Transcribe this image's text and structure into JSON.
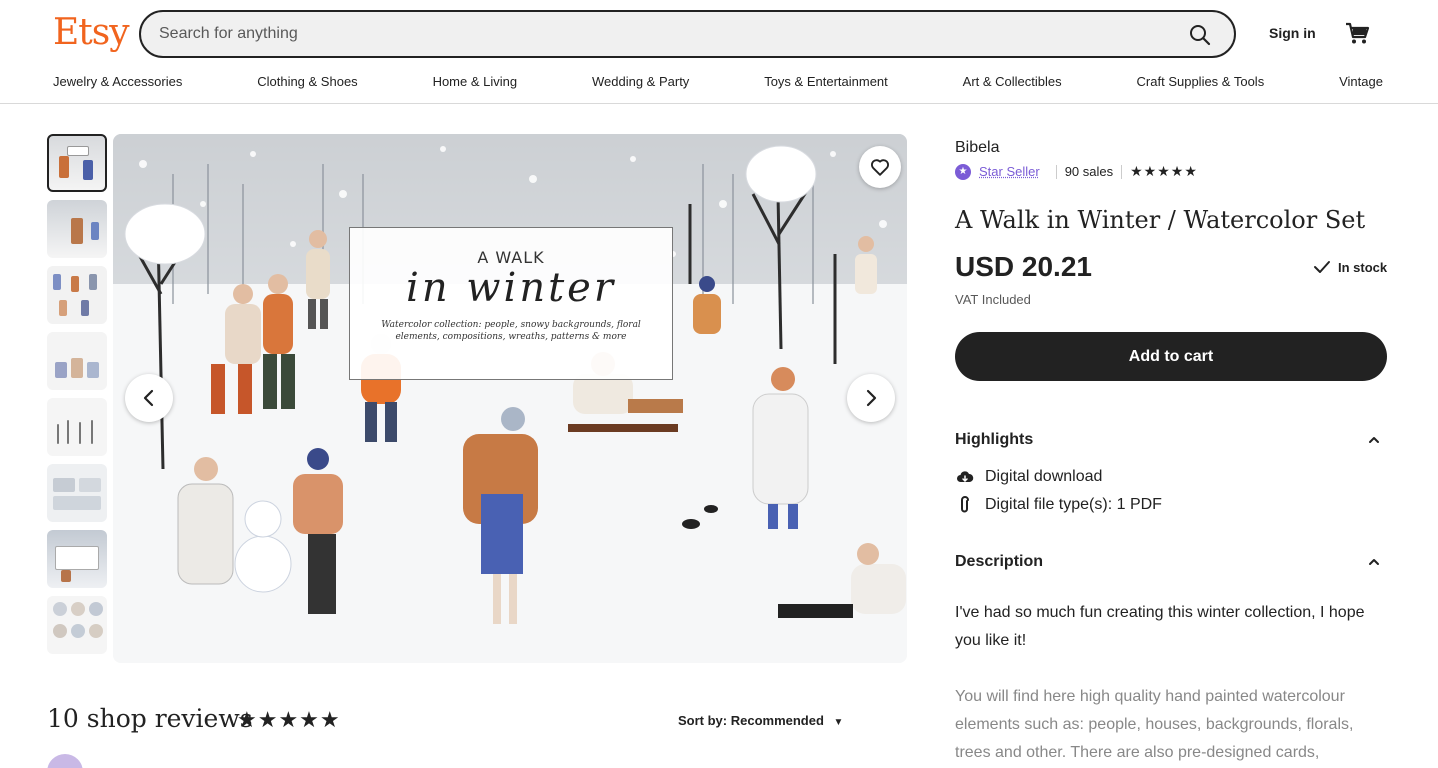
{
  "header": {
    "logo": "Etsy",
    "search_placeholder": "Search for anything",
    "sign_in": "Sign in",
    "icons": [
      "search-icon",
      "cart-icon"
    ]
  },
  "categories": [
    "Jewelry & Accessories",
    "Clothing & Shoes",
    "Home & Living",
    "Wedding & Party",
    "Toys & Entertainment",
    "Art & Collectibles",
    "Craft Supplies & Tools",
    "Vintage"
  ],
  "gallery": {
    "image_title_small": "A WALK",
    "image_title_script": "in winter",
    "image_caption": "Watercolor collection: people, snowy backgrounds, floral elements, compositions, wreaths, patterns & more",
    "thumbnail_count": 8,
    "icons": [
      "heart-icon",
      "chevron-left-icon",
      "chevron-right-icon"
    ]
  },
  "product": {
    "shop_name": "Bibela",
    "star_seller": "Star Seller",
    "sales": "90 sales",
    "rating_stars": "★★★★★",
    "title": "A Walk in Winter / Watercolor Set",
    "price": "USD 20.21",
    "stock": "In stock",
    "vat": "VAT Included",
    "add_to_cart": "Add to cart"
  },
  "highlights": {
    "heading": "Highlights",
    "items": [
      "Digital download",
      "Digital file type(s): 1 PDF"
    ]
  },
  "description": {
    "heading": "Description",
    "p1": "I've had so much fun creating this winter collection, I hope you like it!",
    "p2": "You will find here high quality hand painted watercolour elements such as: people, houses, backgrounds, florals, trees and other. There are also pre-designed cards,"
  },
  "reviews": {
    "title": "10 shop reviews",
    "stars": "★★★★★",
    "sort_label": "Sort by: Recommended"
  },
  "colors": {
    "brand": "#f1641e",
    "star_seller": "#7b5cd6",
    "button": "#222222"
  }
}
